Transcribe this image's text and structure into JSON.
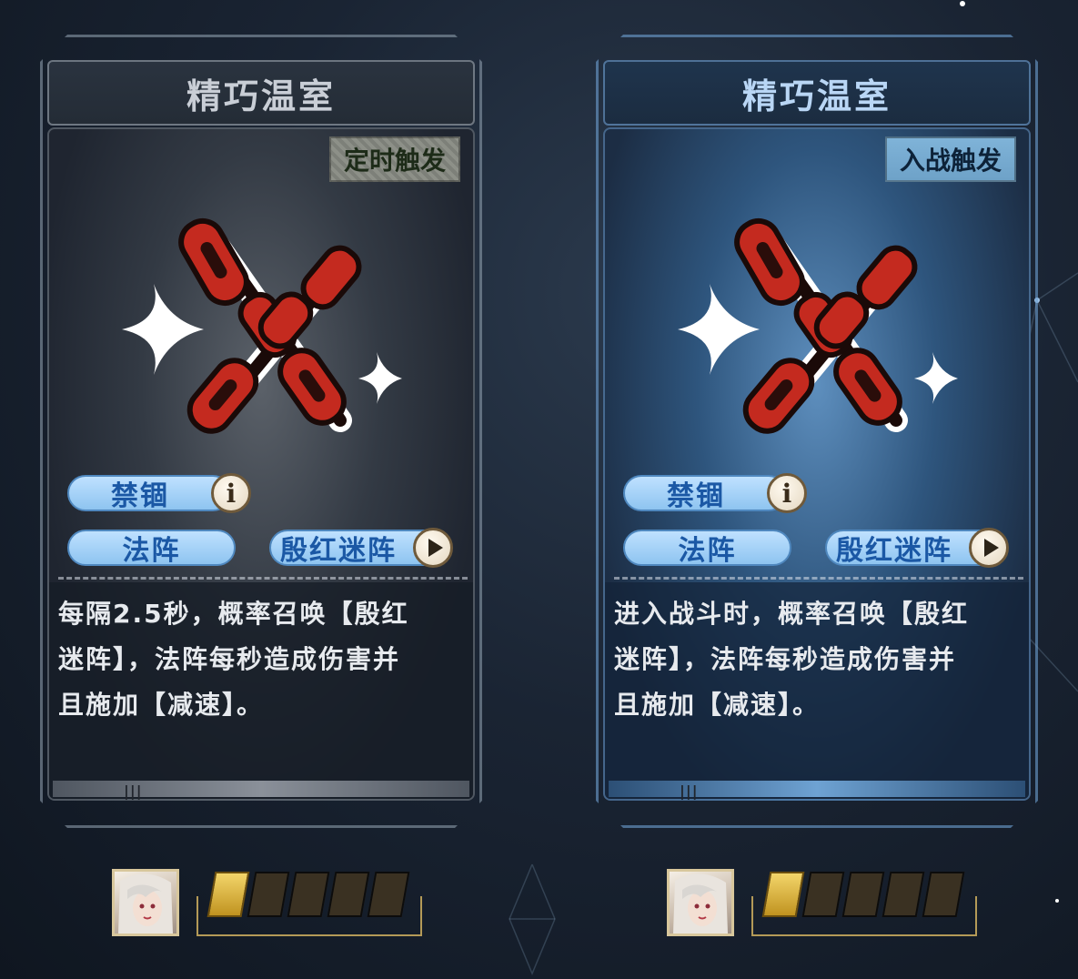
{
  "cards": [
    {
      "title": "精巧温室",
      "trigger": "定时触发",
      "item_icon": "crossed-red-chains-icon",
      "tags": {
        "tag1": "禁锢",
        "tag2": "法阵",
        "tag3": "殷红迷阵"
      },
      "description_lines": [
        "每隔2.5秒，概率召唤【殷红",
        "迷阵】，法阵每秒造成伤害并",
        "且施加【减速】。"
      ],
      "style": "gray"
    },
    {
      "title": "精巧温室",
      "trigger": "入战触发",
      "item_icon": "crossed-red-chains-icon",
      "tags": {
        "tag1": "禁锢",
        "tag2": "法阵",
        "tag3": "殷红迷阵"
      },
      "description_lines": [
        "进入战斗时，概率召唤【殷红",
        "迷阵】，法阵每秒造成伤害并",
        "且施加【减速】。"
      ],
      "style": "blue"
    }
  ],
  "tickets": {
    "total": 5,
    "active": 1
  },
  "colors": {
    "tag_fill": "#8ec4f0",
    "tag_text": "#1b58a5",
    "chain_red": "#c42a1f",
    "ticket_gold": "#d9b03a"
  }
}
